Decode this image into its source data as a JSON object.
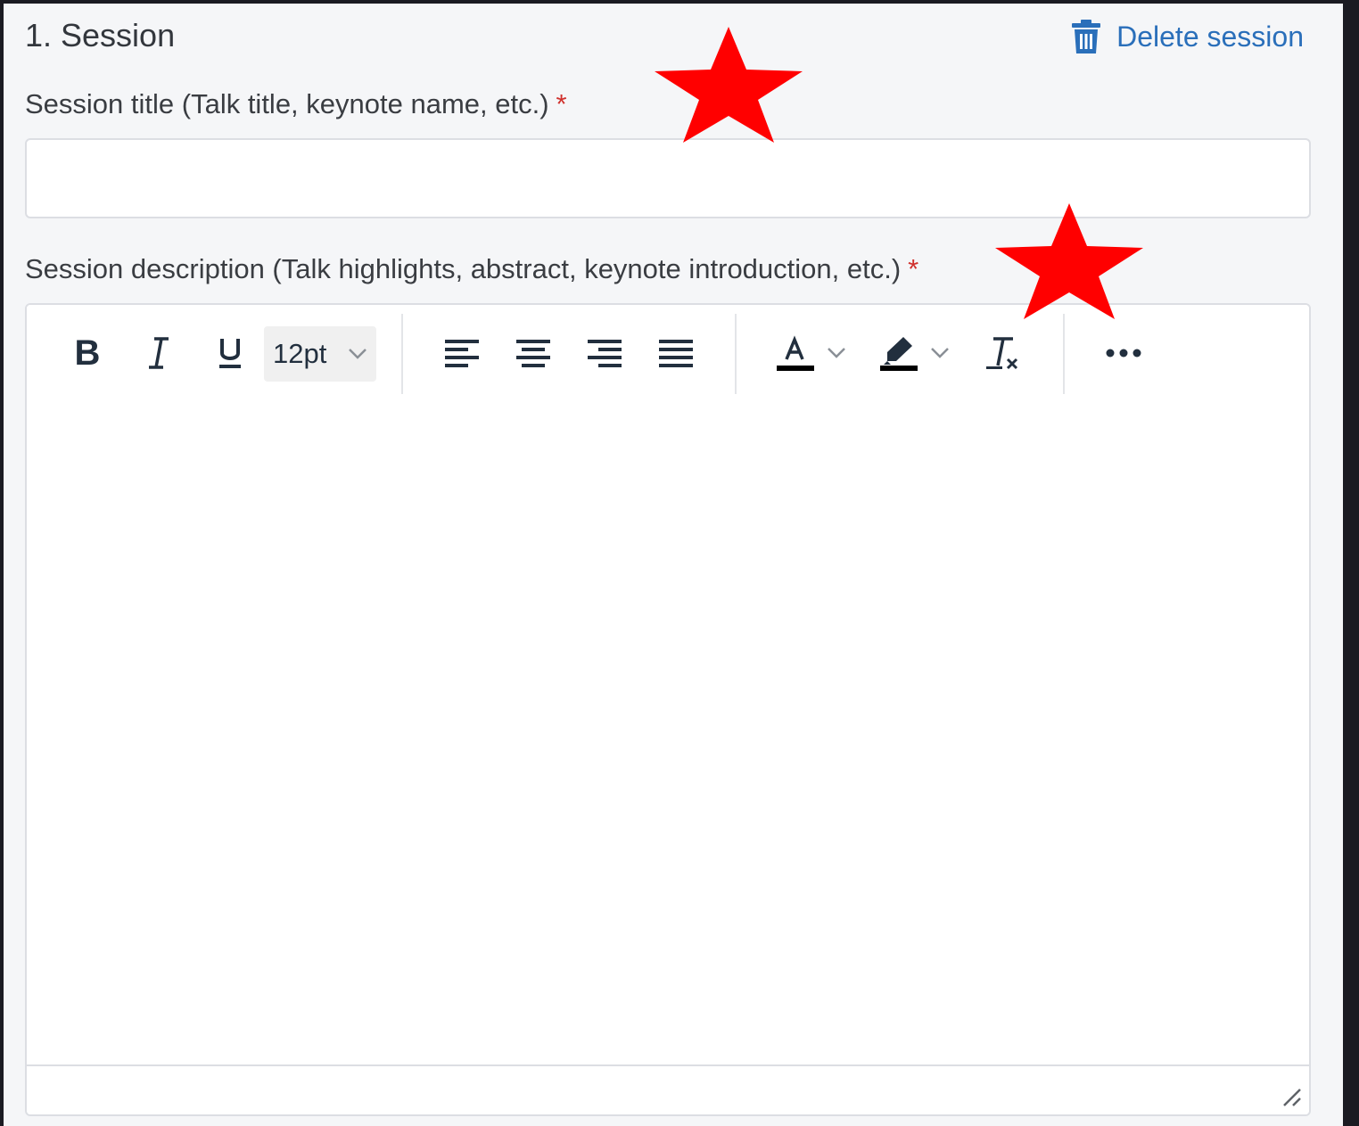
{
  "section": {
    "heading": "1. Session",
    "delete_label": "Delete session"
  },
  "title_field": {
    "label": "Session title (Talk title, keynote name, etc.)",
    "required_marker": "*",
    "value": "",
    "placeholder": ""
  },
  "description_field": {
    "label": "Session description (Talk highlights, abstract, keynote introduction, etc.)",
    "required_marker": "*",
    "content": ""
  },
  "toolbar": {
    "bold_label": "B",
    "font_size": "12pt",
    "icons": [
      "bold-icon",
      "italic-icon",
      "underline-icon",
      "chevron-down-icon",
      "align-left-icon",
      "align-center-icon",
      "align-right-icon",
      "align-justify-icon",
      "text-color-icon",
      "highlight-color-icon",
      "clear-formatting-icon",
      "more-icon"
    ]
  },
  "colors": {
    "accent": "#2a6fba",
    "required": "#d0312d",
    "annotation_star": "#ff0000",
    "panel_bg": "#f5f6f8"
  }
}
